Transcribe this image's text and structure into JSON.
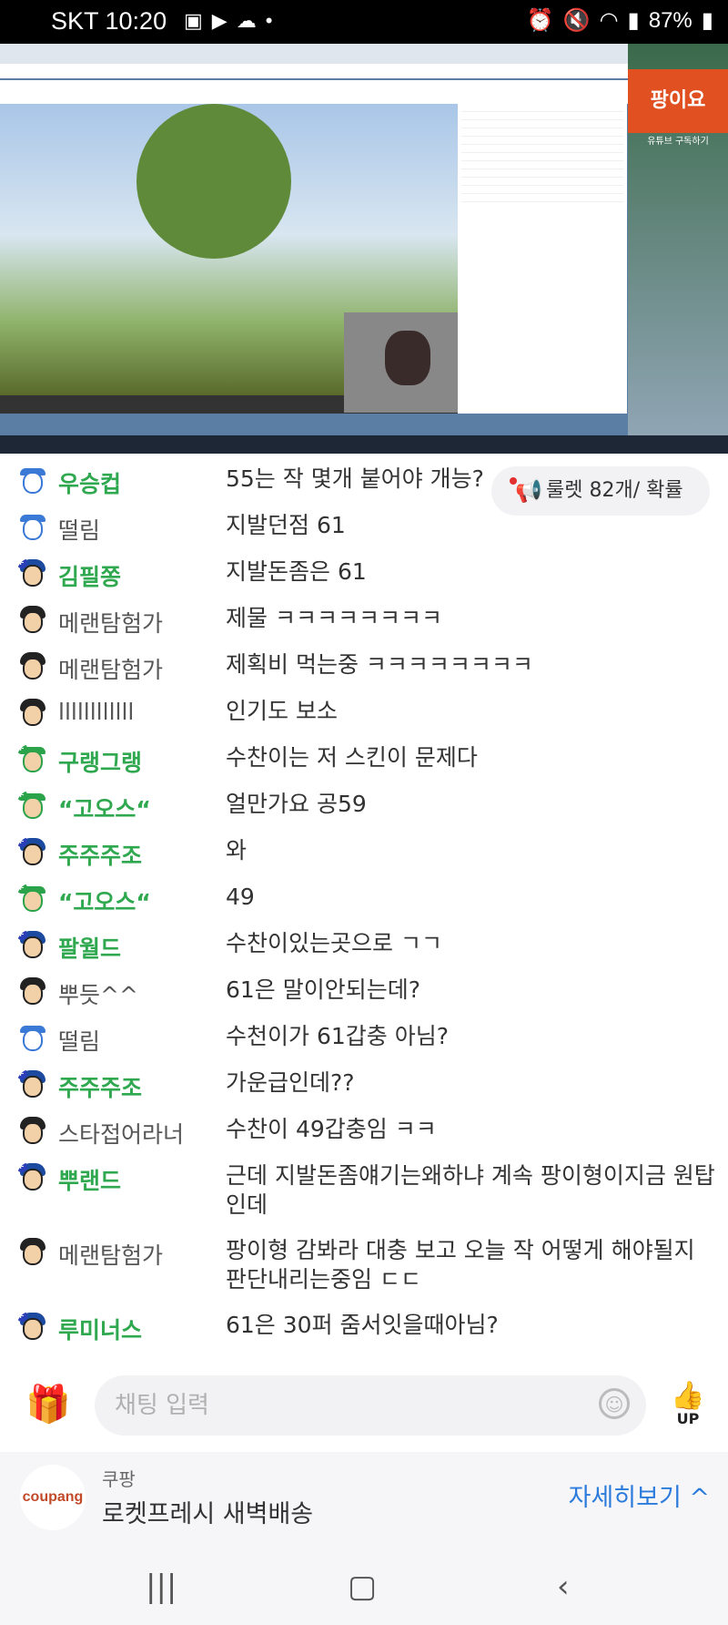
{
  "status_bar": {
    "carrier_time": "SKT 10:20",
    "battery": "87%",
    "left_icons": [
      "image-icon",
      "youtube-icon",
      "cloud-icon",
      "dot-icon"
    ],
    "right_icons": [
      "alarm-icon",
      "mute-icon",
      "wifi-icon",
      "signal-icon",
      "battery-icon"
    ]
  },
  "stream": {
    "channel_overlay": "팡이요",
    "overlay_sub": "유튜브 구독하기"
  },
  "roulette": {
    "label": "룰렛 82개/ 확률"
  },
  "chat": {
    "messages": [
      {
        "avatar": "bear",
        "nick": "우승컵",
        "nick_style": "green",
        "text": "55는 작 몇개 붙어야 개능?"
      },
      {
        "avatar": "bear",
        "nick": "떨림",
        "nick_style": "normal",
        "text": "지발던점 61"
      },
      {
        "avatar": "flag",
        "nick": "김필쫑",
        "nick_style": "green",
        "text": "지발돈좀은 61"
      },
      {
        "avatar": "boy",
        "nick": "메랜탐험가",
        "nick_style": "normal",
        "text": "제물 ㅋㅋㅋㅋㅋㅋㅋㅋ"
      },
      {
        "avatar": "boy",
        "nick": "메랜탐험가",
        "nick_style": "normal",
        "text": "제획비 먹는중 ㅋㅋㅋㅋㅋㅋㅋㅋ"
      },
      {
        "avatar": "boy",
        "nick": "llllllllllll",
        "nick_style": "normal",
        "text": "인기도 보소"
      },
      {
        "avatar": "green",
        "nick": "구랭그랭",
        "nick_style": "green",
        "text": "수찬이는 저 스킨이 문제다"
      },
      {
        "avatar": "green",
        "nick": "“고오스“",
        "nick_style": "green",
        "text": "얼만가요 공59"
      },
      {
        "avatar": "flag",
        "nick": "주주주조",
        "nick_style": "green",
        "text": "와"
      },
      {
        "avatar": "green",
        "nick": "“고오스“",
        "nick_style": "green",
        "text": "49"
      },
      {
        "avatar": "flag",
        "nick": "팔월드",
        "nick_style": "green",
        "text": "수찬이있는곳으로 ㄱㄱ"
      },
      {
        "avatar": "boy",
        "nick": "뿌듯^^",
        "nick_style": "normal",
        "text": "61은 말이안되는데?"
      },
      {
        "avatar": "bear",
        "nick": "떨림",
        "nick_style": "normal",
        "text": "수천이가 61갑충 아님?"
      },
      {
        "avatar": "flag",
        "nick": "주주주조",
        "nick_style": "green",
        "text": "가운급인데??"
      },
      {
        "avatar": "boy",
        "nick": "스타접어라너",
        "nick_style": "normal",
        "text": "수찬이 49갑충임 ㅋㅋ"
      },
      {
        "avatar": "flag",
        "nick": "뿌랜드",
        "nick_style": "green",
        "text": "근데 지발돈좀얘기는왜하냐 계속 팡이형이지금 원탑인데"
      },
      {
        "avatar": "boy",
        "nick": "메랜탐험가",
        "nick_style": "normal",
        "text": "팡이형 감봐라 대충 보고 오늘 작 어떻게 해야될지 판단내리는중임 ㄷㄷ"
      },
      {
        "avatar": "flag",
        "nick": "루미너스",
        "nick_style": "green",
        "text": "61은 30퍼 줌서잇을때아님?"
      }
    ]
  },
  "input": {
    "placeholder": "채팅 입력",
    "up_label": "UP"
  },
  "ad": {
    "logo_text": "coupang",
    "brand": "쿠팡",
    "slogan": "로켓프레시 새벽배송",
    "cta": "자세히보기 ^"
  },
  "colors": {
    "nick_green": "#2fa84f",
    "link_blue": "#2b7bdc"
  }
}
